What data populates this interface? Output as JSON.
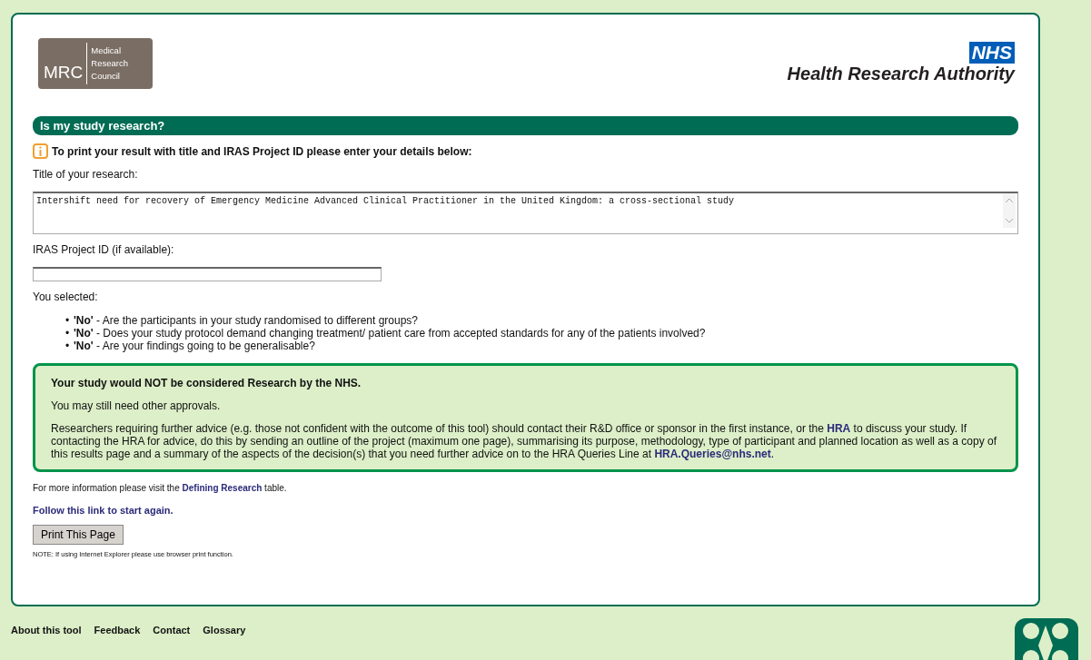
{
  "header": {
    "mrc_logo": {
      "initials": "MRC",
      "lines": [
        "Medical",
        "Research",
        "Council"
      ]
    },
    "nhs_logo": {
      "badge": "NHS",
      "name": "Health Research Authority"
    }
  },
  "title_bar": "Is my study research?",
  "notice": "To print your result with title and IRAS Project ID please enter your details below:",
  "form": {
    "title_label": "Title of your research:",
    "title_value": "Intershift need for recovery of Emergency Medicine Advanced Clinical Practitioner in the United Kingdom: a cross-sectional study",
    "iras_label": "IRAS Project ID (if available):"
  },
  "selected_label": "You selected:",
  "answers": [
    {
      "bullet": "•",
      "text": "**'No'** - Are the participants in your study randomised to different groups?"
    },
    {
      "bullet": "•",
      "text": "**'No'** - Does your study protocol demand changing treatment/ patient care from accepted standards for any of the patients involved?"
    },
    {
      "bullet": "•",
      "text": "**'No'** - Are your findings going to be generalisable?"
    }
  ],
  "result": {
    "heading": "Your study would NOT be considered Research by the NHS.",
    "note": "You may still need other approvals.",
    "advice": [
      {
        "kind": "text",
        "text": "Researchers requiring further advice (e.g. those not confident with the outcome of this tool) should contact their R&D office or sponsor in the first instance, or the "
      },
      {
        "kind": "link",
        "text": "HRA"
      },
      {
        "kind": "text",
        "text": " to discuss your study. If contacting the HRA for advice, do this by sending an outline of the project (maximum one page), summarising its purpose, methodology, type of participant and planned location as well as a copy of this results page and a summary of the aspects of the decision(s) that you need further advice on to the HRA Queries Line at "
      },
      {
        "kind": "link",
        "text": "HRA.Queries@nhs.net"
      },
      {
        "kind": "text",
        "text": "."
      }
    ]
  },
  "more_info": [
    {
      "kind": "text",
      "text": "For more information please visit the "
    },
    {
      "kind": "link",
      "text": "Defining Research"
    },
    {
      "kind": "text",
      "text": " table."
    }
  ],
  "restart_link": "Follow this link to start again.",
  "print_button": "Print This Page",
  "print_note": "NOTE: If using Internet Explorer please use browser print function.",
  "footer_links": [
    "About this tool",
    "Feedback",
    "Contact",
    "Glossary"
  ]
}
